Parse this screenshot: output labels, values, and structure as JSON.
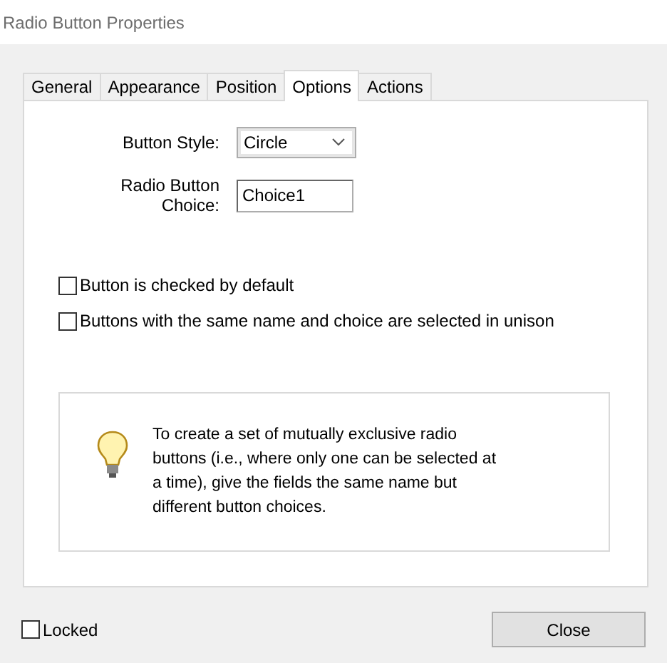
{
  "window": {
    "title": "Radio Button Properties"
  },
  "tabs": [
    {
      "label": "General",
      "selected": false
    },
    {
      "label": "Appearance",
      "selected": false
    },
    {
      "label": "Position",
      "selected": false
    },
    {
      "label": "Options",
      "selected": true
    },
    {
      "label": "Actions",
      "selected": false
    }
  ],
  "button_style": {
    "label": "Button Style:",
    "value": "Circle"
  },
  "radio_choice": {
    "label": "Radio Button Choice:",
    "value": "Choice1"
  },
  "checkboxes": [
    {
      "label": "Button is checked by default",
      "checked": false
    },
    {
      "label": "Buttons with the same name and choice are selected in unison",
      "checked": false
    }
  ],
  "tip": "To create a set of mutually exclusive radio buttons (i.e., where only one can be selected at a time), give the fields the same name but different button choices.",
  "locked": {
    "label": "Locked",
    "checked": false
  },
  "close_button": "Close"
}
